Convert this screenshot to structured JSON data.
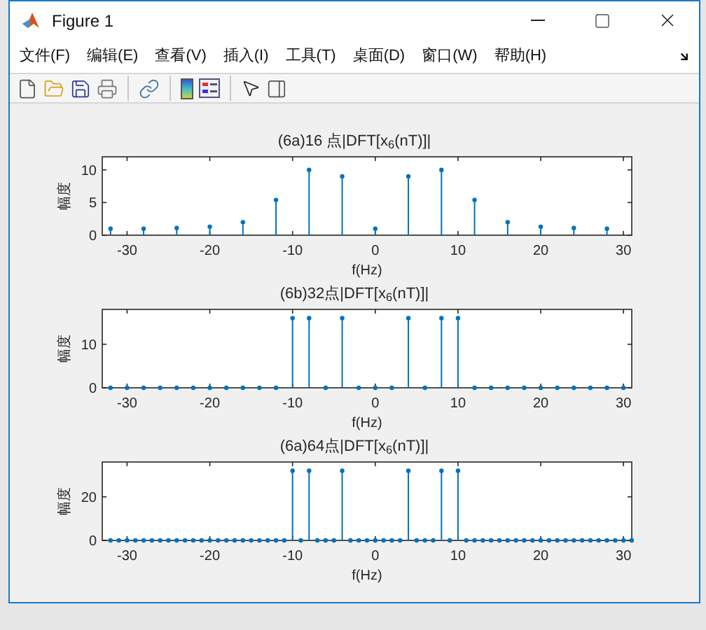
{
  "window": {
    "title": "Figure 1"
  },
  "menu": [
    {
      "label": "文件(F)"
    },
    {
      "label": "编辑(E)"
    },
    {
      "label": "查看(V)"
    },
    {
      "label": "插入(I)"
    },
    {
      "label": "工具(T)"
    },
    {
      "label": "桌面(D)"
    },
    {
      "label": "窗口(W)"
    },
    {
      "label": "帮助(H)"
    }
  ],
  "plots": [
    {
      "chart_data": {
        "type": "bar",
        "title": "(6a)16 点|DFT[x$_{6}$(nT)]|",
        "xlabel": "f(Hz)",
        "ylabel": "幅度",
        "xlim": [
          -33,
          31
        ],
        "ylim": [
          0,
          12
        ],
        "xticks": [
          -30,
          -20,
          -10,
          0,
          10,
          20,
          30
        ],
        "yticks": [
          0,
          5,
          10
        ],
        "x": [
          -32,
          -28,
          -24,
          -20,
          -16,
          -12,
          -8,
          -4,
          0,
          4,
          8,
          12,
          16,
          20,
          24,
          28
        ],
        "series": [
          {
            "color": "#0072bd",
            "values": [
              1,
              1,
              1.1,
              1.3,
              2,
              5.4,
              10,
              9,
              1,
              9,
              10,
              5.4,
              2,
              1.3,
              1.1,
              1
            ]
          }
        ]
      }
    },
    {
      "chart_data": {
        "type": "bar",
        "title": "(6b)32点|DFT[x$_{6}$(nT)]|",
        "xlabel": "f(Hz)",
        "ylabel": "幅度",
        "xlim": [
          -33,
          31
        ],
        "ylim": [
          0,
          18
        ],
        "xticks": [
          -30,
          -20,
          -10,
          0,
          10,
          20,
          30
        ],
        "yticks": [
          0,
          10
        ],
        "x": [
          -32,
          -30,
          -28,
          -26,
          -24,
          -22,
          -20,
          -18,
          -16,
          -14,
          -12,
          -10,
          -8,
          -6,
          -4,
          -2,
          0,
          2,
          4,
          6,
          8,
          10,
          12,
          14,
          16,
          18,
          20,
          22,
          24,
          26,
          28,
          30
        ],
        "series": [
          {
            "color": "#0072bd",
            "values": [
              0,
              0,
              0,
              0,
              0,
              0,
              0,
              0,
              0,
              0,
              0,
              16,
              16,
              0,
              16,
              0,
              0,
              0,
              16,
              0,
              16,
              16,
              0,
              0,
              0,
              0,
              0,
              0,
              0,
              0,
              0,
              0
            ]
          }
        ]
      }
    },
    {
      "chart_data": {
        "type": "bar",
        "title": "(6a)64点|DFT[x$_{6}$(nT)]|",
        "xlabel": "f(Hz)",
        "ylabel": "幅度",
        "xlim": [
          -33,
          31
        ],
        "ylim": [
          0,
          36
        ],
        "xticks": [
          -30,
          -20,
          -10,
          0,
          10,
          20,
          30
        ],
        "yticks": [
          0,
          20
        ],
        "x": [
          -32,
          -31,
          -30,
          -29,
          -28,
          -27,
          -26,
          -25,
          -24,
          -23,
          -22,
          -21,
          -20,
          -19,
          -18,
          -17,
          -16,
          -15,
          -14,
          -13,
          -12,
          -11,
          -10,
          -9,
          -8,
          -7,
          -6,
          -5,
          -4,
          -3,
          -2,
          -1,
          0,
          1,
          2,
          3,
          4,
          5,
          6,
          7,
          8,
          9,
          10,
          11,
          12,
          13,
          14,
          15,
          16,
          17,
          18,
          19,
          20,
          21,
          22,
          23,
          24,
          25,
          26,
          27,
          28,
          29,
          30,
          31
        ],
        "series": [
          {
            "color": "#0072bd",
            "values": [
              0,
              0,
              0,
              0,
              0,
              0,
              0,
              0,
              0,
              0,
              0,
              0,
              0,
              0,
              0,
              0,
              0,
              0,
              0,
              0,
              0,
              0,
              32,
              0,
              32,
              0,
              0,
              0,
              32,
              0,
              0,
              0,
              0,
              0,
              0,
              0,
              32,
              0,
              0,
              0,
              32,
              0,
              32,
              0,
              0,
              0,
              0,
              0,
              0,
              0,
              0,
              0,
              0,
              0,
              0,
              0,
              0,
              0,
              0,
              0,
              0,
              0,
              0,
              0
            ]
          }
        ]
      }
    }
  ]
}
